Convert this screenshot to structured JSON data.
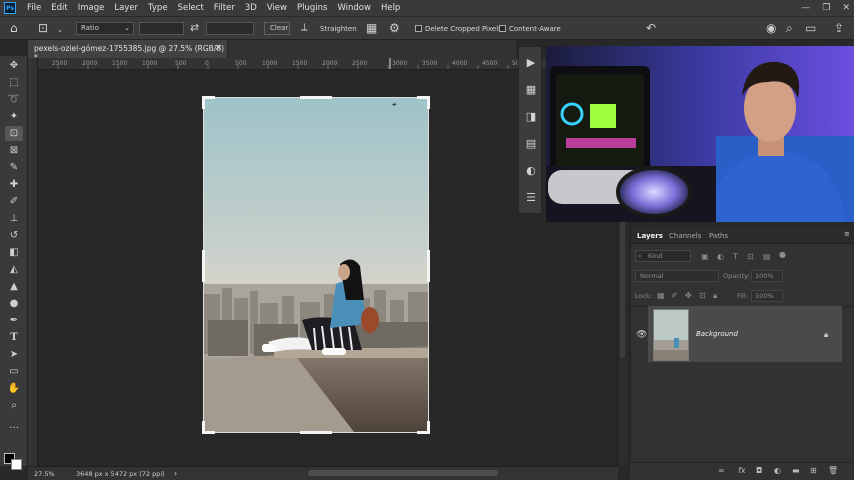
{
  "app": {
    "logo": "Ps",
    "accent": "#31a8ff"
  },
  "menu": [
    "File",
    "Edit",
    "Image",
    "Layer",
    "Type",
    "Select",
    "Filter",
    "3D",
    "View",
    "Plugins",
    "Window",
    "Help"
  ],
  "window_controls": {
    "minimize": "—",
    "maximize": "❐",
    "close": "✕"
  },
  "options_bar": {
    "ratio": "Ratio",
    "clear": "Clear",
    "straighten": "Straighten",
    "delete_cropped": "Delete Cropped Pixels",
    "content_aware": "Content-Aware"
  },
  "document": {
    "tab_title": "pexels-oziel-gómez-1755385.jpg @ 27.5% (RGB/8) *",
    "tab_close": "×"
  },
  "ruler": {
    "ticks": [
      "2500",
      "2000",
      "1500",
      "1000",
      "500",
      "0",
      "500",
      "1000",
      "1500",
      "2000",
      "2500",
      "3000",
      "3500",
      "4000",
      "4500",
      "50"
    ]
  },
  "status": {
    "zoom": "27.5%",
    "doc_info": "3648 px x 5472 px (72 ppi)",
    "arrow": "›"
  },
  "layers_panel": {
    "tabs": [
      "Layers",
      "Channels",
      "Paths"
    ],
    "kind": "Kind",
    "blend_mode": "Normal",
    "opacity_label": "Opacity:",
    "opacity_value": "100%",
    "lock_label": "Lock:",
    "fill_label": "Fill:",
    "fill_value": "100%",
    "layer_name": "Background"
  },
  "colors": {
    "panel_bg": "#323232",
    "menubar_bg": "#3a3a3a",
    "canvas_bg": "#282828"
  }
}
